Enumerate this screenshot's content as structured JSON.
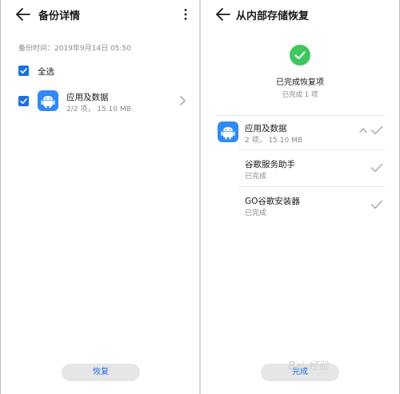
{
  "left_screen": {
    "title": "备份详情",
    "backup_time": "备份时间：2019年9月14日 05:50",
    "select_all_label": "全选",
    "app_item": {
      "name": "应用及数据",
      "detail": "2/2 项， 15.10 MB"
    },
    "restore_button": "恢复"
  },
  "right_screen": {
    "title": "从内部存储恢复",
    "status_title": "已完成恢复项",
    "status_sub": "已完成 1 项",
    "group": {
      "name": "应用及数据",
      "detail": "2 项， 15.10 MB"
    },
    "items": [
      {
        "name": "谷歌服务助手",
        "status": "已完成"
      },
      {
        "name": "GO谷歌安装器",
        "status": "已完成"
      }
    ],
    "done_button": "完成"
  },
  "watermark": "Bai 经验",
  "colors": {
    "accent": "#1e6fe0",
    "success": "#3dc75c",
    "app_icon": "#2f8af5"
  },
  "icons": [
    "back-arrow-icon",
    "more-vert-icon",
    "android-icon",
    "chevron-right-icon",
    "chevron-up-icon",
    "check-icon"
  ]
}
